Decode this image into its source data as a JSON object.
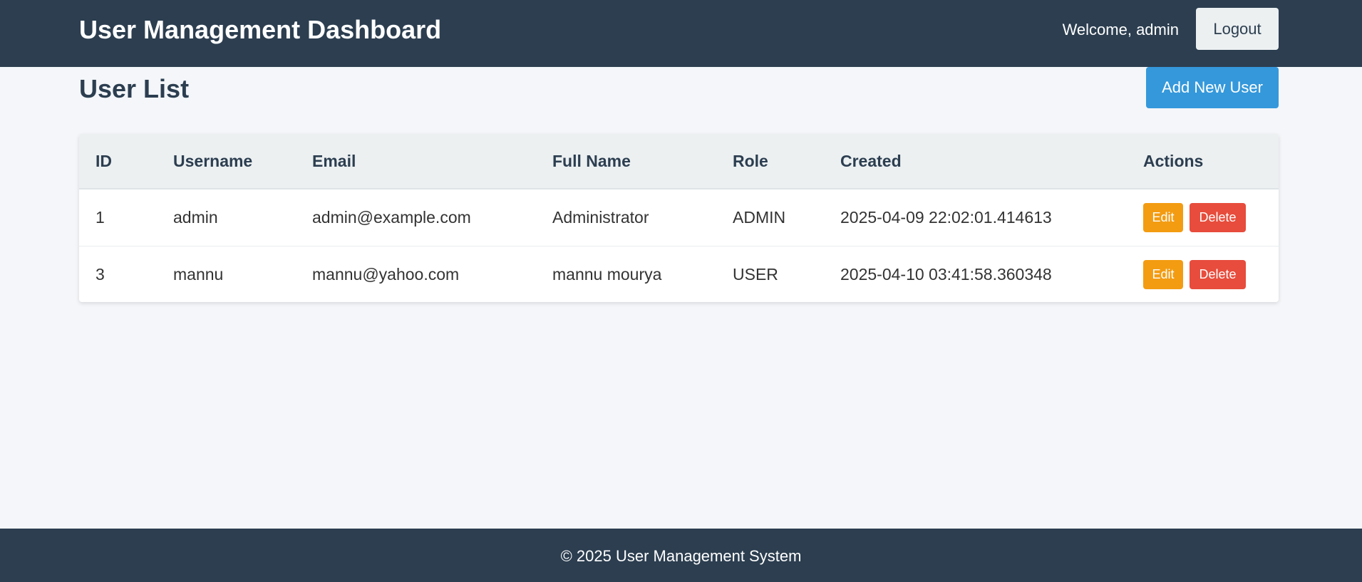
{
  "header": {
    "title": "User Management Dashboard",
    "welcome_text": "Welcome, admin",
    "logout_label": "Logout"
  },
  "main": {
    "page_title": "User List",
    "add_user_label": "Add New User",
    "table": {
      "columns": [
        "ID",
        "Username",
        "Email",
        "Full Name",
        "Role",
        "Created",
        "Actions"
      ],
      "rows": [
        {
          "id": "1",
          "username": "admin",
          "email": "admin@example.com",
          "full_name": "Administrator",
          "role": "ADMIN",
          "created": "2025-04-09 22:02:01.414613",
          "edit_label": "Edit",
          "delete_label": "Delete"
        },
        {
          "id": "3",
          "username": "mannu",
          "email": "mannu@yahoo.com",
          "full_name": "mannu mourya",
          "role": "USER",
          "created": "2025-04-10 03:41:58.360348",
          "edit_label": "Edit",
          "delete_label": "Delete"
        }
      ]
    }
  },
  "footer": {
    "text": "© 2025 User Management System"
  },
  "colors": {
    "header_bg": "#2c3e50",
    "page_bg": "#f4f6f9",
    "primary": "#3498db",
    "edit": "#f39c12",
    "delete": "#e74c3c",
    "table_header_bg": "#ecf0f1"
  }
}
